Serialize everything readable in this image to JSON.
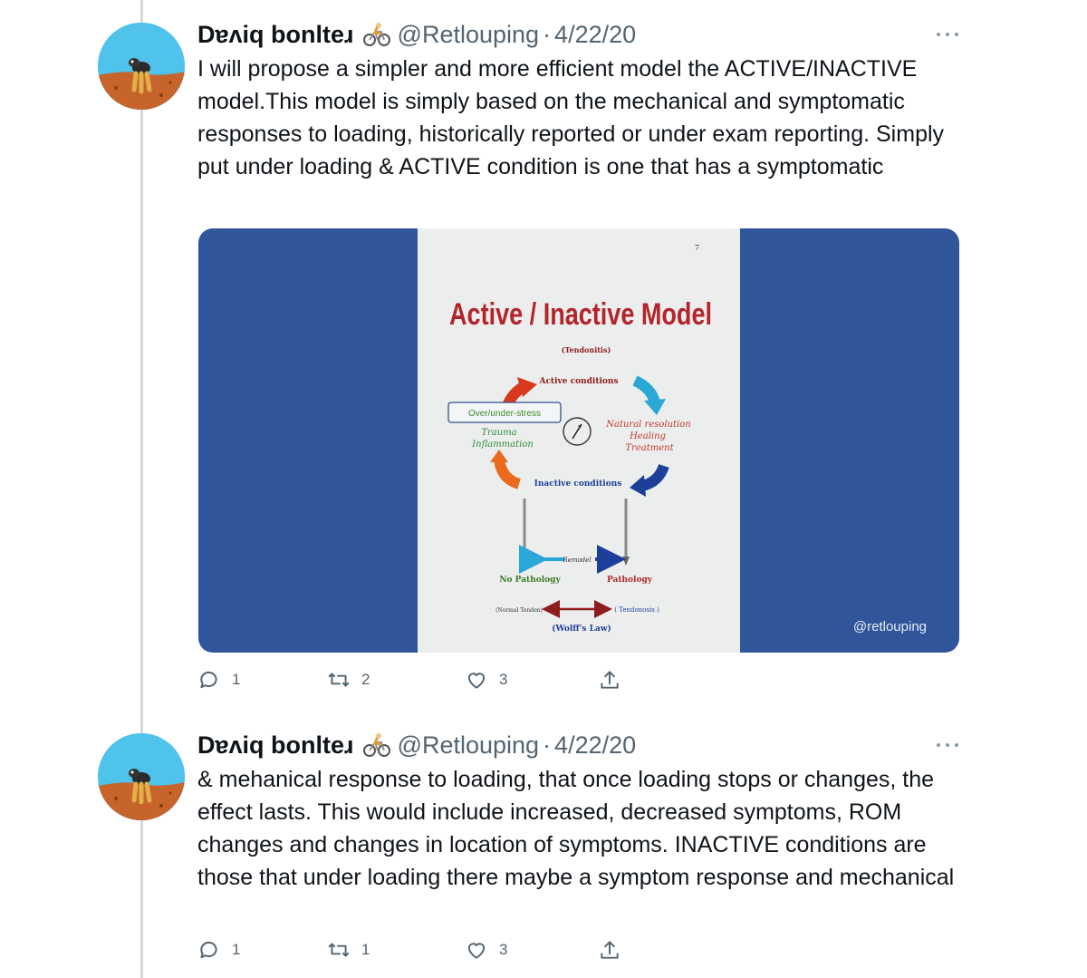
{
  "tweets": [
    {
      "author_name": "Dɐʌiq bonlteɹ",
      "handle": "@Retlouping",
      "separator": "·",
      "date": "4/22/20",
      "text": "I will propose a simpler and more efficient model the ACTIVE/INACTIVE model.This model is simply based on the mechanical and symptomatic responses to loading, historically reported or under exam reporting. Simply put under loading & ACTIVE condition is one that has a symptomatic",
      "media": {
        "watermark": "@retlouping",
        "slide": {
          "page_number": "7",
          "title": "Active / Inactive Model",
          "tendonitis": "(Tendonitis)",
          "active_conditions": "Active conditions",
          "over_under_stress": "Over/under-stress",
          "trauma": "Trauma",
          "inflammation": "Inflammation",
          "natural_resolution": "Natural resolution",
          "healing": "Healing",
          "treatment": "Treatment",
          "inactive_conditions": "Inactive conditions",
          "remodel": "Remodel",
          "no_pathology": "No Pathology",
          "pathology": "Pathology",
          "normal_tendon": "(Normal Tendon)",
          "tendonosis": "( Tendonosis )",
          "wolffs_law": "(Wolff's Law)"
        }
      },
      "actions": {
        "replies": "1",
        "retweets": "2",
        "likes": "3"
      }
    },
    {
      "author_name": "Dɐʌiq bonlteɹ",
      "handle": "@Retlouping",
      "separator": "·",
      "date": "4/22/20",
      "text": "& mehanical response to loading, that once loading stops or changes, the effect lasts. This would include increased, decreased symptoms, ROM changes and changes in location of symptoms. INACTIVE conditions are those that under loading there maybe a symptom response and mechanical",
      "actions": {
        "replies": "1",
        "retweets": "1",
        "likes": "3"
      }
    }
  ],
  "icons": {
    "reply": "reply-icon",
    "retweet": "retweet-icon",
    "like": "heart-icon",
    "share": "share-icon",
    "more": "more-icon",
    "bike": "bicycle-emoji-icon"
  },
  "colors": {
    "media_bg": "#30559b",
    "thread_line": "#cfd9de",
    "secondary_text": "#536471",
    "avatar_sky": "#4fc3ec",
    "avatar_ground": "#c6642c"
  }
}
